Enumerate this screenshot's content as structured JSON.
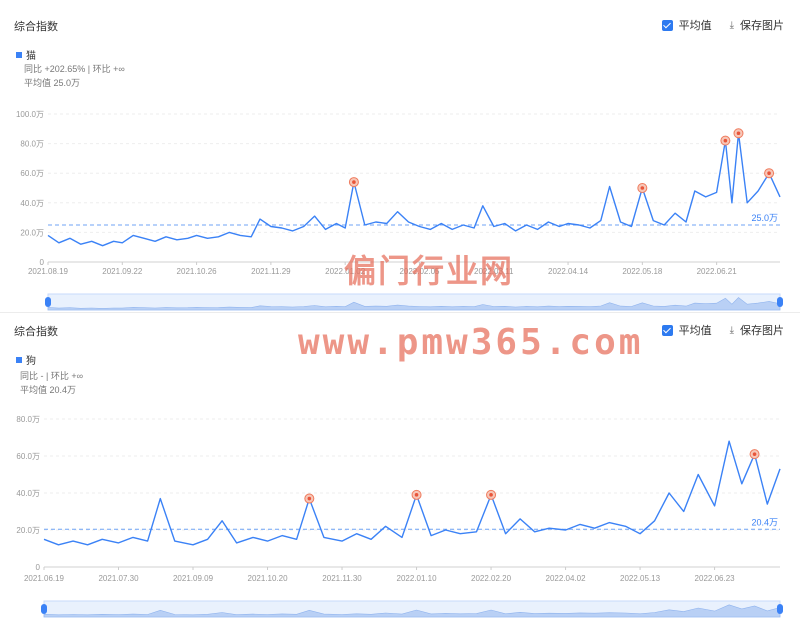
{
  "toolbar": {
    "avg_label": "平均值",
    "save_label": "保存图片"
  },
  "watermark": {
    "line1": "偏门行业网",
    "line2": "www.pmw365.com"
  },
  "charts": [
    {
      "panel_title": "综合指数",
      "series_name": "猫",
      "stat_yoy": "同比 +202.65% | 环比 +∞",
      "stat_avg": "平均值 25.0万",
      "avg_label": "25.0万"
    },
    {
      "panel_title": "综合指数",
      "series_name": "狗",
      "stat_yoy": "同比 - | 环比 +∞",
      "stat_avg": "平均值 20.4万",
      "avg_label": "20.4万"
    }
  ],
  "chart_data": [
    {
      "type": "line",
      "title": "综合指数",
      "series": [
        {
          "name": "猫"
        }
      ],
      "ylim": [
        0,
        100
      ],
      "y_ticks": [
        "0",
        "20.0万",
        "40.0万",
        "60.0万",
        "80.0万",
        "100.0万"
      ],
      "x_ticks": [
        "2021.08.19",
        "2021.09.22",
        "2021.10.26",
        "2021.11.29",
        "2022.01.02",
        "2022.02.05",
        "2022.03.11",
        "2022.04.14",
        "2022.05.18",
        "2022.06.21"
      ],
      "x_start": "2021.08.19",
      "x_end": "2022.07.20",
      "average": 25.0,
      "points": [
        [
          "2021.08.19",
          18
        ],
        [
          "2021.08.24",
          13
        ],
        [
          "2021.08.29",
          16
        ],
        [
          "2021.09.03",
          12
        ],
        [
          "2021.09.08",
          14
        ],
        [
          "2021.09.13",
          11
        ],
        [
          "2021.09.18",
          14
        ],
        [
          "2021.09.22",
          13
        ],
        [
          "2021.09.27",
          18
        ],
        [
          "2021.10.02",
          16
        ],
        [
          "2021.10.07",
          14
        ],
        [
          "2021.10.12",
          17
        ],
        [
          "2021.10.17",
          15
        ],
        [
          "2021.10.22",
          16
        ],
        [
          "2021.10.26",
          18
        ],
        [
          "2021.10.31",
          16
        ],
        [
          "2021.11.05",
          17
        ],
        [
          "2021.11.10",
          20
        ],
        [
          "2021.11.15",
          18
        ],
        [
          "2021.11.20",
          17
        ],
        [
          "2021.11.24",
          29
        ],
        [
          "2021.11.29",
          24
        ],
        [
          "2021.12.04",
          23
        ],
        [
          "2021.12.09",
          21
        ],
        [
          "2021.12.14",
          24
        ],
        [
          "2021.12.19",
          31
        ],
        [
          "2021.12.24",
          22
        ],
        [
          "2021.12.29",
          26
        ],
        [
          "2022.01.02",
          23
        ],
        [
          "2022.01.06",
          54
        ],
        [
          "2022.01.11",
          25
        ],
        [
          "2022.01.16",
          27
        ],
        [
          "2022.01.21",
          26
        ],
        [
          "2022.01.26",
          34
        ],
        [
          "2022.01.31",
          27
        ],
        [
          "2022.02.05",
          24
        ],
        [
          "2022.02.10",
          22
        ],
        [
          "2022.02.15",
          26
        ],
        [
          "2022.02.20",
          22
        ],
        [
          "2022.02.25",
          25
        ],
        [
          "2022.03.02",
          23
        ],
        [
          "2022.03.06",
          38
        ],
        [
          "2022.03.11",
          24
        ],
        [
          "2022.03.16",
          26
        ],
        [
          "2022.03.21",
          21
        ],
        [
          "2022.03.26",
          25
        ],
        [
          "2022.03.31",
          22
        ],
        [
          "2022.04.05",
          27
        ],
        [
          "2022.04.10",
          24
        ],
        [
          "2022.04.14",
          26
        ],
        [
          "2022.04.19",
          25
        ],
        [
          "2022.04.24",
          23
        ],
        [
          "2022.04.29",
          28
        ],
        [
          "2022.05.03",
          51
        ],
        [
          "2022.05.08",
          27
        ],
        [
          "2022.05.13",
          24
        ],
        [
          "2022.05.18",
          50
        ],
        [
          "2022.05.23",
          28
        ],
        [
          "2022.05.28",
          25
        ],
        [
          "2022.06.02",
          33
        ],
        [
          "2022.06.07",
          27
        ],
        [
          "2022.06.11",
          48
        ],
        [
          "2022.06.16",
          44
        ],
        [
          "2022.06.21",
          47
        ],
        [
          "2022.06.25",
          82
        ],
        [
          "2022.06.28",
          40
        ],
        [
          "2022.07.01",
          87
        ],
        [
          "2022.07.05",
          40
        ],
        [
          "2022.07.10",
          48
        ],
        [
          "2022.07.15",
          60
        ],
        [
          "2022.07.20",
          44
        ]
      ],
      "markers": [
        [
          "2022.01.06",
          54
        ],
        [
          "2022.05.18",
          50
        ],
        [
          "2022.06.25",
          82
        ],
        [
          "2022.07.01",
          87
        ],
        [
          "2022.07.15",
          60
        ]
      ]
    },
    {
      "type": "line",
      "title": "综合指数",
      "series": [
        {
          "name": "狗"
        }
      ],
      "ylim": [
        0,
        80
      ],
      "y_ticks": [
        "0",
        "20.0万",
        "40.0万",
        "60.0万",
        "80.0万"
      ],
      "x_ticks": [
        "2021.06.19",
        "2021.07.30",
        "2021.09.09",
        "2021.10.20",
        "2021.11.30",
        "2022.01.10",
        "2022.02.20",
        "2022.04.02",
        "2022.05.13",
        "2022.06.23"
      ],
      "x_start": "2021.06.19",
      "x_end": "2022.07.29",
      "average": 20.4,
      "points": [
        [
          "2021.06.19",
          15
        ],
        [
          "2021.06.27",
          12
        ],
        [
          "2021.07.05",
          14
        ],
        [
          "2021.07.13",
          12
        ],
        [
          "2021.07.21",
          15
        ],
        [
          "2021.07.30",
          13
        ],
        [
          "2021.08.07",
          16
        ],
        [
          "2021.08.15",
          14
        ],
        [
          "2021.08.22",
          37
        ],
        [
          "2021.08.30",
          14
        ],
        [
          "2021.09.09",
          12
        ],
        [
          "2021.09.17",
          15
        ],
        [
          "2021.09.25",
          25
        ],
        [
          "2021.10.03",
          13
        ],
        [
          "2021.10.12",
          16
        ],
        [
          "2021.10.20",
          14
        ],
        [
          "2021.10.28",
          17
        ],
        [
          "2021.11.05",
          15
        ],
        [
          "2021.11.12",
          37
        ],
        [
          "2021.11.20",
          16
        ],
        [
          "2021.11.30",
          14
        ],
        [
          "2021.12.08",
          18
        ],
        [
          "2021.12.16",
          15
        ],
        [
          "2021.12.24",
          22
        ],
        [
          "2022.01.02",
          16
        ],
        [
          "2022.01.10",
          39
        ],
        [
          "2022.01.18",
          17
        ],
        [
          "2022.01.26",
          20
        ],
        [
          "2022.02.03",
          18
        ],
        [
          "2022.02.12",
          19
        ],
        [
          "2022.02.20",
          39
        ],
        [
          "2022.02.28",
          18
        ],
        [
          "2022.03.08",
          26
        ],
        [
          "2022.03.16",
          19
        ],
        [
          "2022.03.24",
          21
        ],
        [
          "2022.04.02",
          20
        ],
        [
          "2022.04.10",
          23
        ],
        [
          "2022.04.18",
          21
        ],
        [
          "2022.04.26",
          24
        ],
        [
          "2022.05.05",
          22
        ],
        [
          "2022.05.13",
          18
        ],
        [
          "2022.05.21",
          25
        ],
        [
          "2022.05.29",
          40
        ],
        [
          "2022.06.06",
          30
        ],
        [
          "2022.06.14",
          50
        ],
        [
          "2022.06.23",
          33
        ],
        [
          "2022.07.01",
          68
        ],
        [
          "2022.07.08",
          45
        ],
        [
          "2022.07.15",
          61
        ],
        [
          "2022.07.22",
          34
        ],
        [
          "2022.07.29",
          53
        ]
      ],
      "markers": [
        [
          "2021.11.12",
          37
        ],
        [
          "2022.01.10",
          39
        ],
        [
          "2022.02.20",
          39
        ],
        [
          "2022.07.15",
          61
        ]
      ]
    }
  ]
}
